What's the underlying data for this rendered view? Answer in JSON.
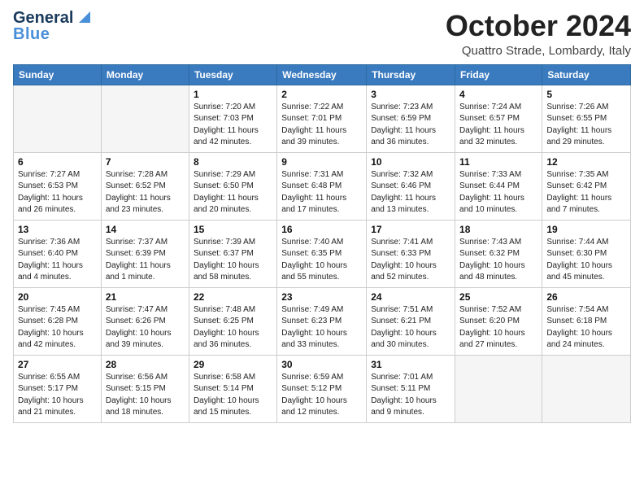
{
  "header": {
    "logo_line1": "General",
    "logo_line2": "Blue",
    "month_title": "October 2024",
    "location": "Quattro Strade, Lombardy, Italy"
  },
  "days_of_week": [
    "Sunday",
    "Monday",
    "Tuesday",
    "Wednesday",
    "Thursday",
    "Friday",
    "Saturday"
  ],
  "weeks": [
    [
      {
        "day": "",
        "info": ""
      },
      {
        "day": "",
        "info": ""
      },
      {
        "day": "1",
        "info": "Sunrise: 7:20 AM\nSunset: 7:03 PM\nDaylight: 11 hours and 42 minutes."
      },
      {
        "day": "2",
        "info": "Sunrise: 7:22 AM\nSunset: 7:01 PM\nDaylight: 11 hours and 39 minutes."
      },
      {
        "day": "3",
        "info": "Sunrise: 7:23 AM\nSunset: 6:59 PM\nDaylight: 11 hours and 36 minutes."
      },
      {
        "day": "4",
        "info": "Sunrise: 7:24 AM\nSunset: 6:57 PM\nDaylight: 11 hours and 32 minutes."
      },
      {
        "day": "5",
        "info": "Sunrise: 7:26 AM\nSunset: 6:55 PM\nDaylight: 11 hours and 29 minutes."
      }
    ],
    [
      {
        "day": "6",
        "info": "Sunrise: 7:27 AM\nSunset: 6:53 PM\nDaylight: 11 hours and 26 minutes."
      },
      {
        "day": "7",
        "info": "Sunrise: 7:28 AM\nSunset: 6:52 PM\nDaylight: 11 hours and 23 minutes."
      },
      {
        "day": "8",
        "info": "Sunrise: 7:29 AM\nSunset: 6:50 PM\nDaylight: 11 hours and 20 minutes."
      },
      {
        "day": "9",
        "info": "Sunrise: 7:31 AM\nSunset: 6:48 PM\nDaylight: 11 hours and 17 minutes."
      },
      {
        "day": "10",
        "info": "Sunrise: 7:32 AM\nSunset: 6:46 PM\nDaylight: 11 hours and 13 minutes."
      },
      {
        "day": "11",
        "info": "Sunrise: 7:33 AM\nSunset: 6:44 PM\nDaylight: 11 hours and 10 minutes."
      },
      {
        "day": "12",
        "info": "Sunrise: 7:35 AM\nSunset: 6:42 PM\nDaylight: 11 hours and 7 minutes."
      }
    ],
    [
      {
        "day": "13",
        "info": "Sunrise: 7:36 AM\nSunset: 6:40 PM\nDaylight: 11 hours and 4 minutes."
      },
      {
        "day": "14",
        "info": "Sunrise: 7:37 AM\nSunset: 6:39 PM\nDaylight: 11 hours and 1 minute."
      },
      {
        "day": "15",
        "info": "Sunrise: 7:39 AM\nSunset: 6:37 PM\nDaylight: 10 hours and 58 minutes."
      },
      {
        "day": "16",
        "info": "Sunrise: 7:40 AM\nSunset: 6:35 PM\nDaylight: 10 hours and 55 minutes."
      },
      {
        "day": "17",
        "info": "Sunrise: 7:41 AM\nSunset: 6:33 PM\nDaylight: 10 hours and 52 minutes."
      },
      {
        "day": "18",
        "info": "Sunrise: 7:43 AM\nSunset: 6:32 PM\nDaylight: 10 hours and 48 minutes."
      },
      {
        "day": "19",
        "info": "Sunrise: 7:44 AM\nSunset: 6:30 PM\nDaylight: 10 hours and 45 minutes."
      }
    ],
    [
      {
        "day": "20",
        "info": "Sunrise: 7:45 AM\nSunset: 6:28 PM\nDaylight: 10 hours and 42 minutes."
      },
      {
        "day": "21",
        "info": "Sunrise: 7:47 AM\nSunset: 6:26 PM\nDaylight: 10 hours and 39 minutes."
      },
      {
        "day": "22",
        "info": "Sunrise: 7:48 AM\nSunset: 6:25 PM\nDaylight: 10 hours and 36 minutes."
      },
      {
        "day": "23",
        "info": "Sunrise: 7:49 AM\nSunset: 6:23 PM\nDaylight: 10 hours and 33 minutes."
      },
      {
        "day": "24",
        "info": "Sunrise: 7:51 AM\nSunset: 6:21 PM\nDaylight: 10 hours and 30 minutes."
      },
      {
        "day": "25",
        "info": "Sunrise: 7:52 AM\nSunset: 6:20 PM\nDaylight: 10 hours and 27 minutes."
      },
      {
        "day": "26",
        "info": "Sunrise: 7:54 AM\nSunset: 6:18 PM\nDaylight: 10 hours and 24 minutes."
      }
    ],
    [
      {
        "day": "27",
        "info": "Sunrise: 6:55 AM\nSunset: 5:17 PM\nDaylight: 10 hours and 21 minutes."
      },
      {
        "day": "28",
        "info": "Sunrise: 6:56 AM\nSunset: 5:15 PM\nDaylight: 10 hours and 18 minutes."
      },
      {
        "day": "29",
        "info": "Sunrise: 6:58 AM\nSunset: 5:14 PM\nDaylight: 10 hours and 15 minutes."
      },
      {
        "day": "30",
        "info": "Sunrise: 6:59 AM\nSunset: 5:12 PM\nDaylight: 10 hours and 12 minutes."
      },
      {
        "day": "31",
        "info": "Sunrise: 7:01 AM\nSunset: 5:11 PM\nDaylight: 10 hours and 9 minutes."
      },
      {
        "day": "",
        "info": ""
      },
      {
        "day": "",
        "info": ""
      }
    ]
  ]
}
